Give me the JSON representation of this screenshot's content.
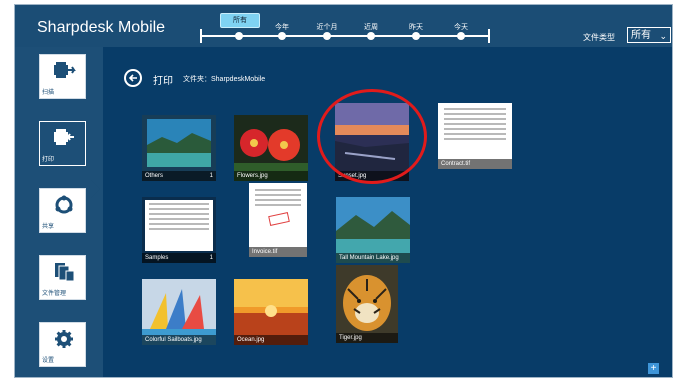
{
  "app": {
    "title": "Sharpdesk Mobile"
  },
  "timeline": {
    "current_label": "所有",
    "points": [
      "今年",
      "近个月",
      "近周",
      "昨天",
      "今天"
    ]
  },
  "filter": {
    "label": "文件类型",
    "value": "所有"
  },
  "sidebar": {
    "items": [
      {
        "label": "扫描",
        "icon": "scan-icon"
      },
      {
        "label": "打印",
        "icon": "print-icon",
        "active": true
      },
      {
        "label": "共享",
        "icon": "share-icon"
      },
      {
        "label": "文件管理",
        "icon": "file-manage-icon"
      },
      {
        "label": "设置",
        "icon": "gear-icon"
      }
    ]
  },
  "content": {
    "title": "打印",
    "breadcrumb": "文件夹：SharpdeskMobile",
    "tiles": [
      {
        "name": "Others",
        "count": "1",
        "type": "folder"
      },
      {
        "name": "Flowers.jpg",
        "type": "image"
      },
      {
        "name": "Sunset.jpg",
        "type": "image",
        "highlighted": true
      },
      {
        "name": "Contract.tif",
        "type": "document"
      },
      {
        "name": "Samples",
        "count": "1",
        "type": "folder"
      },
      {
        "name": "Invoice.tif",
        "type": "document"
      },
      {
        "name": "Tall Mountain Lake.jpg",
        "type": "image"
      },
      {
        "name": "Colorful Sailboats.jpg",
        "type": "image"
      },
      {
        "name": "Ocean.jpg",
        "type": "image"
      },
      {
        "name": "Tiger.jpg",
        "type": "image"
      }
    ],
    "add_label": "+"
  },
  "colors": {
    "background": "#1d4f77",
    "content": "#083c68",
    "accent": "#3e95d8",
    "highlight": "#e11b1b"
  }
}
